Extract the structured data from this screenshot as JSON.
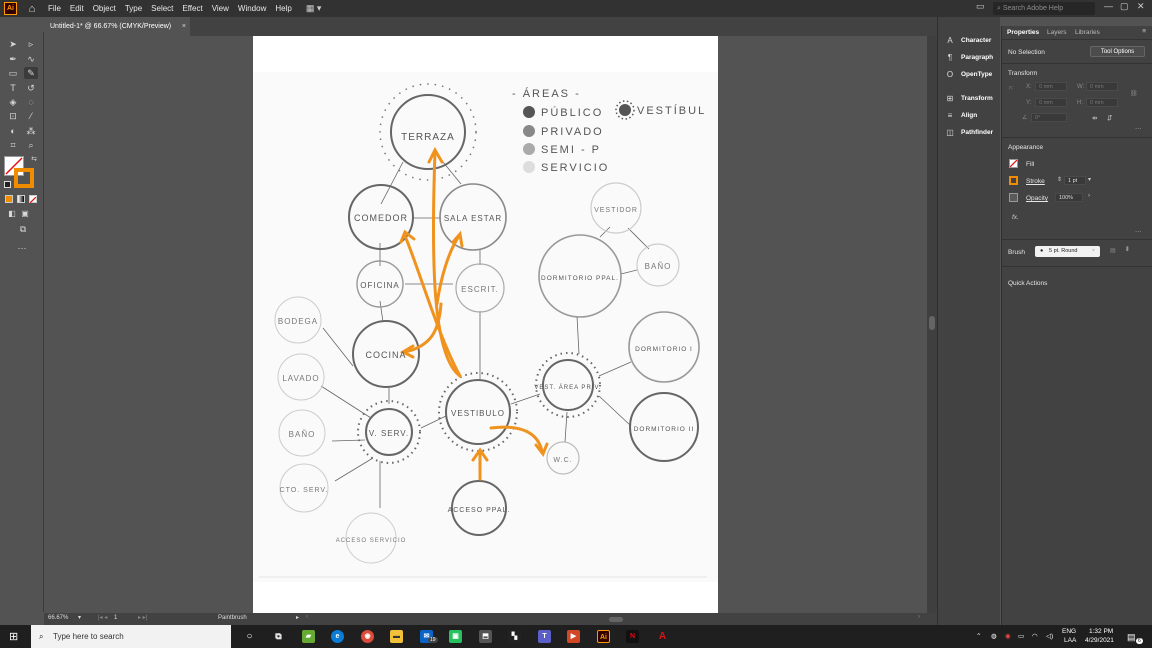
{
  "menubar": {
    "logo": "Ai",
    "items": [
      "File",
      "Edit",
      "Object",
      "Type",
      "Select",
      "Effect",
      "View",
      "Window",
      "Help"
    ],
    "search_placeholder": "Search Adobe Help"
  },
  "document_tab": {
    "title": "Untitled-1* @ 66.67% (CMYK/Preview)",
    "close": "×"
  },
  "dock": {
    "items": [
      "Character",
      "Paragraph",
      "OpenType",
      "Transform",
      "Align",
      "Pathfinder"
    ]
  },
  "properties": {
    "tabs": [
      "Properties",
      "Layers",
      "Libraries"
    ],
    "selection": "No Selection",
    "tool_options_button": "Tool Options",
    "transform_heading": "Transform",
    "x_label": "X:",
    "y_label": "Y:",
    "w_label": "W:",
    "h_label": "H:",
    "x_value": "0 mm",
    "y_value": "0 mm",
    "w_value": "0 mm",
    "h_value": "0 mm",
    "angle_value": "0°",
    "appearance_heading": "Appearance",
    "fill_label": "Fill",
    "stroke_label": "Stroke",
    "stroke_value": "1 pt",
    "opacity_label": "Opacity",
    "opacity_value": "100%",
    "fx_label": "fx.",
    "brush_label": "Brush",
    "brush_value": "5 pt. Round",
    "quick_actions": "Quick Actions"
  },
  "statusbar": {
    "zoom": "66.67%",
    "artboard": "1",
    "tool": "Paintbrush"
  },
  "taskbar": {
    "search_placeholder": "Type here to search",
    "language": "ENG",
    "layout": "LAA",
    "time": "1:32 PM",
    "date": "4/29/2021",
    "mail_badge": "19",
    "notification_count": "6"
  },
  "sketch": {
    "legend_title": "- ÁREAS -",
    "legend": [
      "PÚBLICO",
      "PRIVADO",
      "SEMI - P",
      "SERVICIO",
      "VESTÍBUL"
    ],
    "nodes": [
      "TERRAZA",
      "COMEDOR",
      "SALA ESTAR",
      "OFICINA",
      "ESCRIT.",
      "COCINA",
      "BODEGA",
      "LAVADO",
      "BAÑO",
      "CTO. SERV.",
      "V. SERV.",
      "VESTIBULO",
      "ACCESO PPAL.",
      "ACCESO SERVICIO",
      "VEST. ÁREA PRIV.",
      "W.C.",
      "VESTIDOR",
      "BAÑO",
      "DORMITORIO PPAL.",
      "DORMITORIO I",
      "DORMITORIO II"
    ]
  }
}
